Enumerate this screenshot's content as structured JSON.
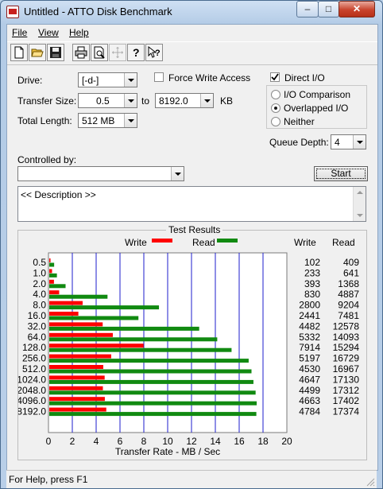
{
  "window": {
    "title": "Untitled - ATTO Disk Benchmark"
  },
  "window_buttons": {
    "minimize": "–",
    "maximize": "□",
    "close": "✕"
  },
  "menu": [
    "File",
    "View",
    "Help"
  ],
  "toolbar": [
    "new-icon",
    "open-icon",
    "save-icon",
    "print-icon",
    "print-preview-icon",
    "move-icon",
    "help-icon",
    "context-help-icon"
  ],
  "form": {
    "drive_label": "Drive:",
    "drive_value": "[-d-]",
    "force_write_label": "Force Write Access",
    "force_write_checked": false,
    "direct_io_label": "Direct I/O",
    "direct_io_checked": true,
    "transfer_size_label": "Transfer Size:",
    "transfer_from": "0.5",
    "to_label": "to",
    "transfer_to": "8192.0",
    "kb_label": "KB",
    "total_length_label": "Total Length:",
    "total_length_value": "512 MB",
    "io_options": [
      {
        "label": "I/O Comparison",
        "selected": false
      },
      {
        "label": "Overlapped I/O",
        "selected": true
      },
      {
        "label": "Neither",
        "selected": false
      }
    ],
    "queue_depth_label": "Queue Depth:",
    "queue_depth_value": "4",
    "controlled_by_label": "Controlled by:",
    "controlled_by_value": "",
    "start_label": "Start",
    "description": "<< Description >>"
  },
  "results": {
    "title": "Test Results",
    "write_legend": "Write",
    "read_legend": "Read",
    "write_header": "Write",
    "read_header": "Read",
    "write_color": "#ff0000",
    "read_color": "#118a11",
    "rows": [
      {
        "size": "0.5",
        "write": "102",
        "read": "409"
      },
      {
        "size": "1.0",
        "write": "233",
        "read": "641"
      },
      {
        "size": "2.0",
        "write": "393",
        "read": "1368"
      },
      {
        "size": "4.0",
        "write": "830",
        "read": "4887"
      },
      {
        "size": "8.0",
        "write": "2800",
        "read": "9204"
      },
      {
        "size": "16.0",
        "write": "2441",
        "read": "7481"
      },
      {
        "size": "32.0",
        "write": "4482",
        "read": "12578"
      },
      {
        "size": "64.0",
        "write": "5332",
        "read": "14093"
      },
      {
        "size": "128.0",
        "write": "7914",
        "read": "15294"
      },
      {
        "size": "256.0",
        "write": "5197",
        "read": "16729"
      },
      {
        "size": "512.0",
        "write": "4530",
        "read": "16967"
      },
      {
        "size": "1024.0",
        "write": "4647",
        "read": "17130"
      },
      {
        "size": "2048.0",
        "write": "4499",
        "read": "17312"
      },
      {
        "size": "4096.0",
        "write": "4663",
        "read": "17402"
      },
      {
        "size": "8192.0",
        "write": "4784",
        "read": "17374"
      }
    ],
    "x_ticks": [
      "0",
      "2",
      "4",
      "6",
      "8",
      "10",
      "12",
      "14",
      "16",
      "18",
      "20"
    ],
    "x_axis_label": "Transfer Rate - MB / Sec"
  },
  "chart_data": {
    "type": "bar",
    "xlabel": "Transfer Rate - MB / Sec",
    "ylabel": "",
    "xlim": [
      0,
      20
    ],
    "categories": [
      "0.5",
      "1.0",
      "2.0",
      "4.0",
      "8.0",
      "16.0",
      "32.0",
      "64.0",
      "128.0",
      "256.0",
      "512.0",
      "1024.0",
      "2048.0",
      "4096.0",
      "8192.0"
    ],
    "series": [
      {
        "name": "Write",
        "values": [
          0.102,
          0.233,
          0.393,
          0.83,
          2.8,
          2.441,
          4.482,
          5.332,
          7.914,
          5.197,
          4.53,
          4.647,
          4.499,
          4.663,
          4.784
        ]
      },
      {
        "name": "Read",
        "values": [
          0.409,
          0.641,
          1.368,
          4.887,
          9.204,
          7.481,
          12.578,
          14.093,
          15.294,
          16.729,
          16.967,
          17.13,
          17.312,
          17.402,
          17.374
        ]
      }
    ],
    "grid": true,
    "orientation": "horizontal"
  },
  "status": {
    "text": "For Help, press F1"
  }
}
